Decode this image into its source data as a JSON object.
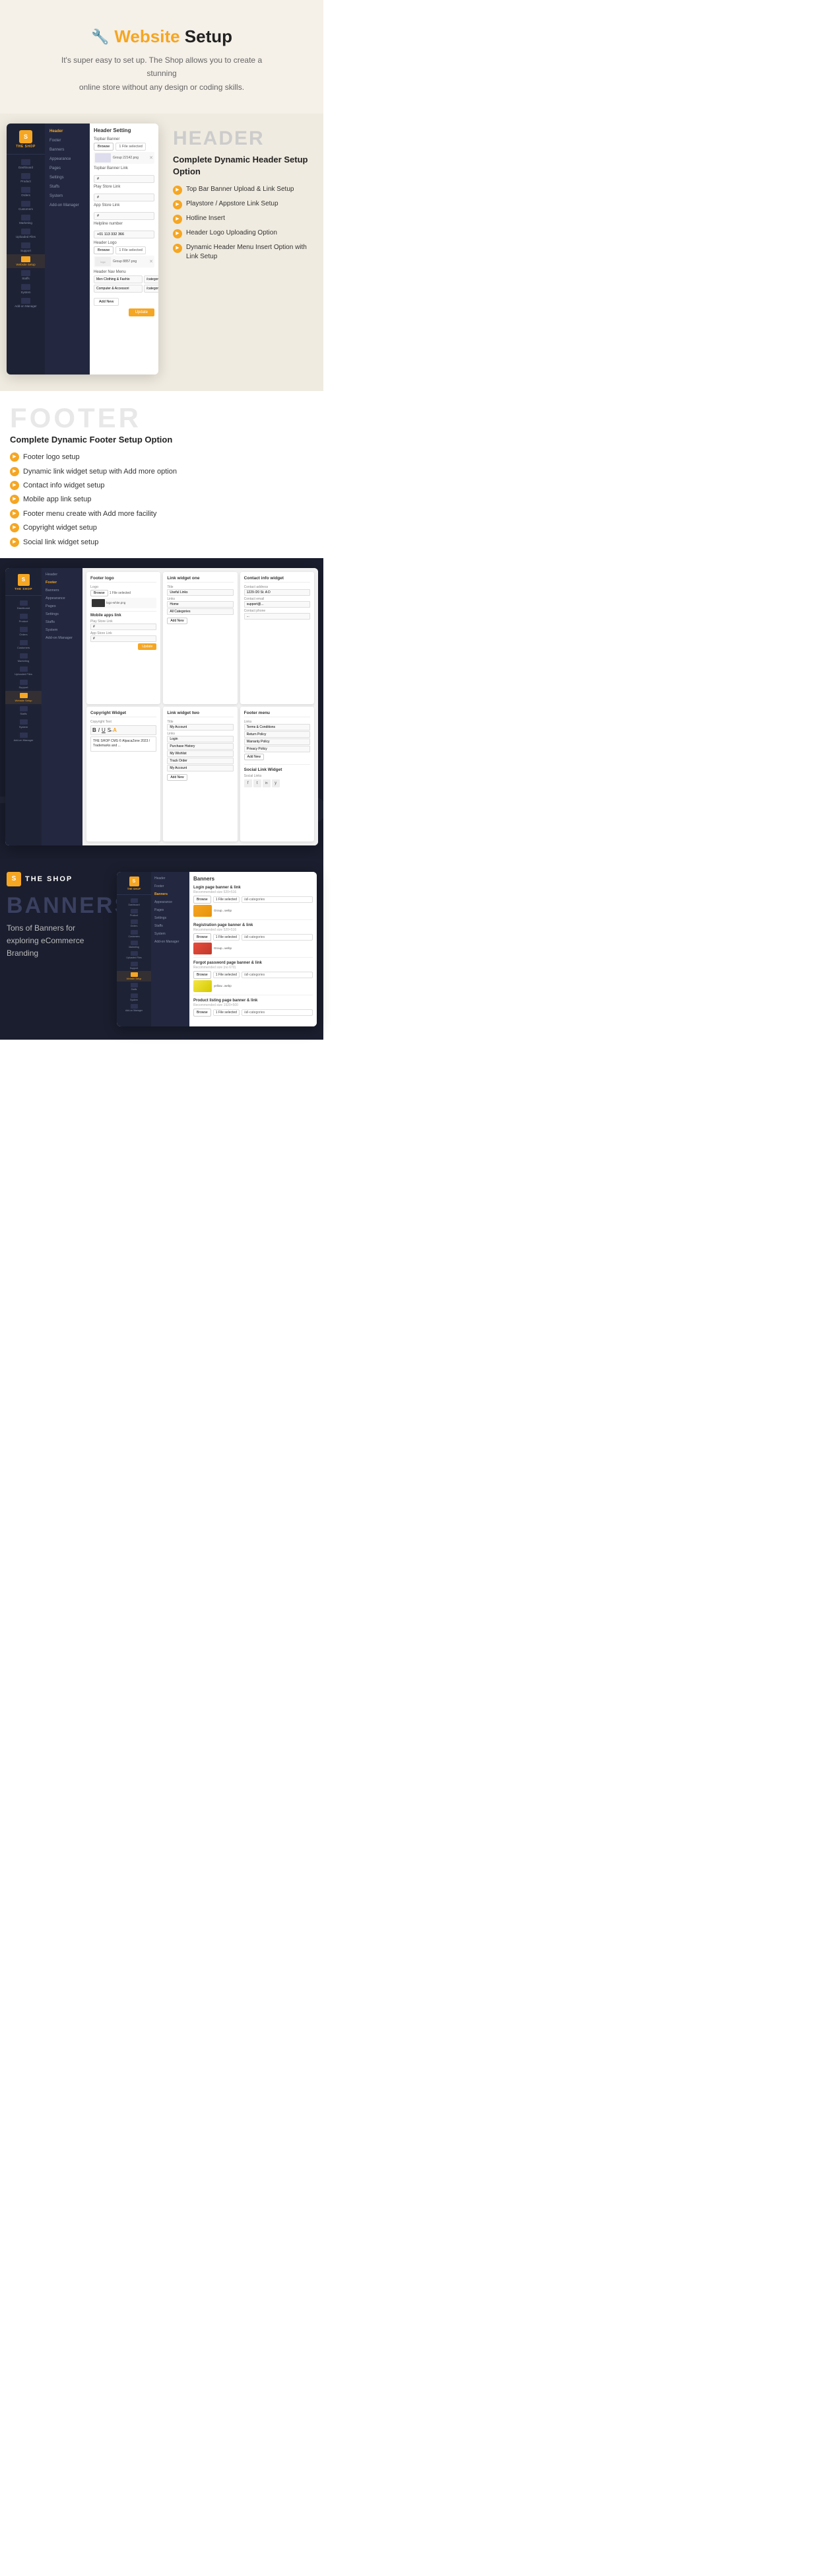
{
  "hero": {
    "icon": "🔧",
    "title_pre": "Website",
    "title_highlight": " Setup",
    "subtitle_line1": "It's super easy to set up. The Shop allows you to create a stunning",
    "subtitle_line2": "online store without any design or coding skills."
  },
  "header_section": {
    "tag": "HEADER",
    "title": "Complete Dynamic Header Setup Option",
    "features": [
      "Top Bar Banner Upload & Link Setup",
      "Playstore / Appstore Link Setup",
      "Hotline Insert",
      "Header Logo Uploading Option",
      "Dynamic Header Menu Insert Option with Link Setup"
    ],
    "form": {
      "title": "Header Setting",
      "topbar_banner_label": "Topbar Banner",
      "topbar_banner_file": "1 File selected",
      "topbar_banner_img": "Group 22142.png",
      "topbar_banner_link_label": "Topbar Banner Link",
      "topbar_banner_link_val": "#",
      "play_store_label": "Play Store Link",
      "play_store_val": "#",
      "app_store_label": "App Store Link",
      "app_store_val": "#",
      "helpline_label": "Helpline number",
      "helpline_val": "+01 113 332 366",
      "header_logo_label": "Header Logo",
      "header_logo_file": "1 File selected",
      "header_logo_img": "Group 8857.png",
      "header_nav_label": "Header Nav Menu",
      "menu_items": [
        {
          "name": "Men Clothing & Fashio",
          "link": "/category/men-clothing-fashion"
        },
        {
          "name": "Computer & Accessori",
          "link": "/category/computer-accessories"
        }
      ],
      "add_new": "Add New",
      "update_btn": "Update"
    }
  },
  "sidebar": {
    "shop_icon": "S",
    "shop_name": "THE SHOP",
    "nav_items": [
      {
        "label": "Dashboard",
        "active": false
      },
      {
        "label": "Product",
        "active": false
      },
      {
        "label": "Orders",
        "active": false
      },
      {
        "label": "Customers",
        "active": false
      },
      {
        "label": "Marketing",
        "active": false
      },
      {
        "label": "Uploaded Files",
        "active": false
      },
      {
        "label": "Support",
        "active": false
      },
      {
        "label": "Website Setup",
        "active": true
      },
      {
        "label": "Staffs",
        "active": false
      },
      {
        "label": "System",
        "active": false
      },
      {
        "label": "Add-on Manager",
        "active": false
      }
    ],
    "sub_items": [
      {
        "label": "Header",
        "active": true
      },
      {
        "label": "Footer",
        "active": false
      },
      {
        "label": "Banners",
        "active": false
      },
      {
        "label": "Appearance",
        "active": false
      },
      {
        "label": "Pages",
        "active": false
      },
      {
        "label": "Settings",
        "active": false
      },
      {
        "label": "Staffs",
        "active": false
      },
      {
        "label": "System",
        "active": false
      },
      {
        "label": "Add-on Manager",
        "active": false
      }
    ]
  },
  "footer_section": {
    "tag": "FOOTER",
    "title": "Complete Dynamic Footer Setup Option",
    "features": [
      "Footer logo setup",
      "Dynamic link widget setup with Add more option",
      "Contact info widget setup",
      "Mobile app link setup",
      "Footer menu create with Add more facility",
      "Copyright widget setup",
      "Social link widget setup"
    ],
    "bg_text": "THE SHOP",
    "shop_icon": "S",
    "shop_name": "THE SHOP",
    "footer_logo_label": "Footer logo",
    "logo_input_label": "Logo",
    "logo_file": "1 File selected",
    "logo_browse": "Browse",
    "logo_img_name": "logo-white.png",
    "mobile_apps_label": "Mobile apps link",
    "play_store_label": "Play Store Link",
    "app_store_label": "App Store Link",
    "link_widget_one_title": "Link widget one",
    "lw1_title_label": "Title",
    "lw1_title_val": "Useful Links",
    "lw1_links_label": "Links",
    "lw1_links": [
      "Home",
      "All Categories"
    ],
    "link_widget_two_title": "Link widget two",
    "lw2_title_label": "Title",
    "lw2_title_val": "My Account",
    "lw2_links": [
      "Login",
      "Purchase History",
      "My Wishlist",
      "Track Order",
      "My Account"
    ],
    "contact_info_title": "Contact info widget",
    "ci_address_label": "Contact address",
    "ci_address_val": "1229 /20 St. A D",
    "ci_email_label": "Contact email",
    "ci_email_val": "support@...",
    "copyright_title": "Copyright Widget",
    "copyright_text_label": "Copyright Text",
    "copyright_content": "THE SHOP CMS © AlpacaZone 2023 / Trademarks and ...",
    "footer_menu_title": "Footer menu",
    "fm_links": [
      "Terms & Conditions",
      "Return Policy",
      "Warranty Policy",
      "Privacy Policy"
    ],
    "social_title": "Social Link Widget",
    "social_links_label": "Social Links",
    "social_icons": [
      "f",
      "t",
      "in",
      "y"
    ]
  },
  "banners_section": {
    "tag": "BANNERS",
    "title": "Tons of Banners for exploring eCommerce Branding",
    "shop_icon": "S",
    "shop_name": "THE SHOP",
    "form_title": "Banners",
    "banners": [
      {
        "label": "Login page banner & link",
        "note": "Recommended size 520×516",
        "file": "1 File selected",
        "link": "/all-categories",
        "img_name": "Group...webp",
        "img_size": "47 kB",
        "img_color": "orange"
      },
      {
        "label": "Registration page banner & link",
        "note": "Recommended size 520×516",
        "file": "1 File selected",
        "link": "/all-categories",
        "img_name": "Group...webp",
        "img_size": "38 kB",
        "img_color": "red"
      },
      {
        "label": "Forgot password page banner & link",
        "note": "Recommended size (no 670)",
        "file": "1 File selected",
        "link": "/all-categories",
        "img_name": "yellow...webp",
        "img_size": "",
        "img_color": "yellow"
      },
      {
        "label": "Product listing page banner & link",
        "note": "Recommended size 1920×500",
        "file": "1 File selected",
        "link": "/all-categories",
        "img_name": "",
        "img_size": "",
        "img_color": "orange"
      }
    ],
    "banners_sidebar_sub": [
      {
        "label": "Header",
        "active": false
      },
      {
        "label": "Footer",
        "active": false
      },
      {
        "label": "Banners",
        "active": true
      },
      {
        "label": "Appearance",
        "active": false
      },
      {
        "label": "Pages",
        "active": false
      },
      {
        "label": "Settings",
        "active": false
      },
      {
        "label": "Staffs",
        "active": false
      },
      {
        "label": "System",
        "active": false
      },
      {
        "label": "Add-on Manager",
        "active": false
      }
    ]
  }
}
